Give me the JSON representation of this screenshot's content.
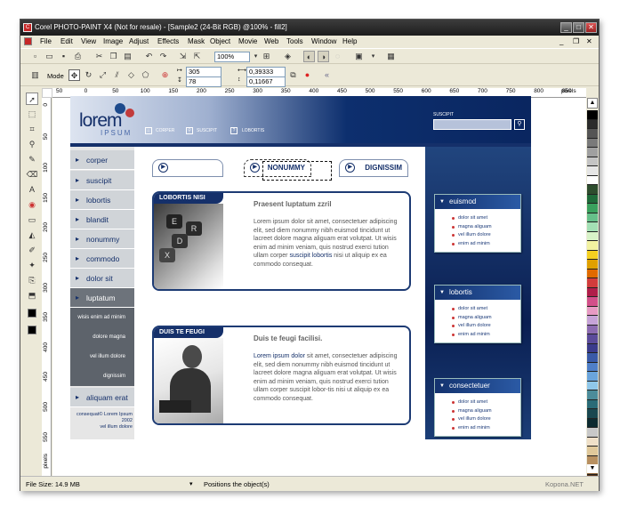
{
  "window": {
    "title": "Corel PHOTO-PAINT X4 (Not for resale) - [Sample2 (24-Bit RGB) @100% - fill2]",
    "controls": {
      "minimize": "_",
      "maximize": "□",
      "close": "✕"
    },
    "doc_controls": {
      "minimize": "_",
      "restore": "❐",
      "close": "✕"
    }
  },
  "menu": [
    "File",
    "Edit",
    "View",
    "Image",
    "Adjust",
    "Effects",
    "Mask",
    "Object",
    "Movie",
    "Web",
    "Tools",
    "Window",
    "Help"
  ],
  "toolbar": {
    "zoom": "100%"
  },
  "property_bar": {
    "mode_label": "Mode",
    "x": "305",
    "y": "78",
    "w": "0,39333",
    "h": "0,11667"
  },
  "ruler": {
    "h_ticks": [
      "50",
      "0",
      "50",
      "100",
      "150",
      "200",
      "250",
      "300",
      "350",
      "400",
      "450",
      "500",
      "550",
      "600",
      "650",
      "700",
      "750",
      "800",
      "850"
    ],
    "h_unit": "pixels",
    "v_ticks": [
      "0",
      "50",
      "100",
      "150",
      "200",
      "250",
      "300",
      "350",
      "400",
      "450",
      "500",
      "550"
    ],
    "v_unit": "pixels"
  },
  "palette": [
    "#000000",
    "#2b2b2b",
    "#555555",
    "#7a7a7a",
    "#a0a0a0",
    "#c4c4c4",
    "#e6e6e6",
    "#ffffff",
    "#2e4d2e",
    "#1f6b3a",
    "#3aa15e",
    "#66c08a",
    "#a3e0b5",
    "#d8f3c8",
    "#f2f2a0",
    "#f5d020",
    "#e0a000",
    "#e06a00",
    "#d23c3c",
    "#b01e4a",
    "#d24f8a",
    "#e79ac4",
    "#c6a3d8",
    "#8c6bb1",
    "#5b4b9a",
    "#3b3b8c",
    "#3a5aa8",
    "#4f7fc8",
    "#6aa4dc",
    "#8fc7ea",
    "#4c8c9a",
    "#2a6b77",
    "#1a4750",
    "#0d2a30",
    "#c8c8c8",
    "#f0e0c8",
    "#e0c89a",
    "#b89060",
    "#8a5c30",
    "#5a3418"
  ],
  "statusbar": {
    "file_size": "File Size: 14.9 MB",
    "message": "Positions the object(s)",
    "watermark": "Kopona.NET"
  },
  "design": {
    "logo_main": "lorem",
    "logo_sub": "IPSUM",
    "top_links": [
      "CORPER",
      "SUSCIPIT",
      "LOBORTIS"
    ],
    "search_label": "SUSCIPIT",
    "tabs": [
      "",
      "NONUMMY",
      "DIGNISSIM"
    ],
    "sidebar": [
      "corper",
      "suscipit",
      "lobortis",
      "blandit",
      "nonummy",
      "commodo",
      "dolor sit",
      "luptatum"
    ],
    "sidebar_sub": [
      "wisis enim ad minim",
      "dolore magna",
      "vel illum dolore",
      "dignissim"
    ],
    "sidebar_last": "aliquam erat",
    "footer": [
      "consequat© Lorem Ipsum",
      "2002",
      "vel illum dolore"
    ],
    "cards": [
      {
        "header": "LOBORTIS NISI",
        "title": "Praesent luptatum zzril",
        "text_a": "Lorem ipsum dolor sit amet, consectetuer adipiscing elit, sed diem nonummy nibh euismod tincidunt ut lacreet dolore magna aliguam erat volutpat. Ut wisis enim ad minim veniam, quis nostrud exerci tution ullam corper ",
        "link": "suscipit lobortis",
        "text_b": " nisi ut aliquip ex ea commodo consequat."
      },
      {
        "header": "DUIS TE FEUGI",
        "title": "Duis te feugi facilisi.",
        "link": "Lorem ipsum dolor",
        "text_b": " sit amet, consectetuer adipiscing elit, sed diem nonummy nibh euismod tincidunt ut lacreet dolore magna aliguam erat volutpat. Ut wisis enim ad minim veniam, quis nostrud exerci tution ullam corper suscipit lobor-tis nisi ut aliquip ex ea commodo consequat."
      }
    ],
    "right_boxes": [
      {
        "title": "euismod",
        "items": [
          "dolor sit amet",
          "magna aliguam",
          "vel illum dolore",
          "enim ad minim"
        ]
      },
      {
        "title": "lobortis",
        "items": [
          "dolor sit amet",
          "magna aliguam",
          "vel illum dolore",
          "enim ad minim"
        ]
      },
      {
        "title": "consectetuer",
        "items": [
          "dolor sit amet",
          "magna aliguam",
          "vel illum dolore",
          "enim ad minim"
        ]
      }
    ]
  }
}
